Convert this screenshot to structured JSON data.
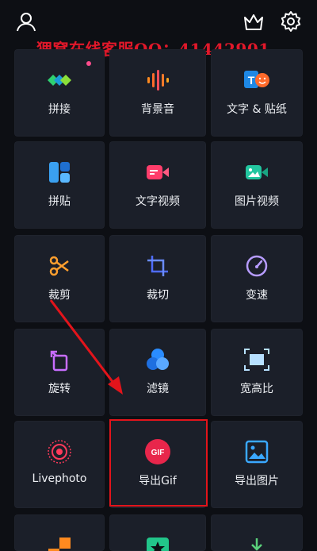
{
  "watermark": "狸窝在线客服QQ：41442901",
  "top_icons": [
    "user-icon",
    "crown-icon",
    "gear-icon"
  ],
  "tiles": [
    {
      "label": "拼接",
      "icon": "splice-icon"
    },
    {
      "label": "背景音",
      "icon": "audio-wave-icon"
    },
    {
      "label": "文字 & 贴纸",
      "icon": "text-sticker-icon"
    },
    {
      "label": "拼贴",
      "icon": "collage-icon"
    },
    {
      "label": "文字视频",
      "icon": "text-video-icon"
    },
    {
      "label": "图片视频",
      "icon": "photo-video-icon"
    },
    {
      "label": "裁剪",
      "icon": "scissors-icon"
    },
    {
      "label": "裁切",
      "icon": "crop-icon"
    },
    {
      "label": "变速",
      "icon": "speedometer-icon"
    },
    {
      "label": "旋转",
      "icon": "rotate-icon"
    },
    {
      "label": "滤镜",
      "icon": "filter-icon"
    },
    {
      "label": "宽高比",
      "icon": "aspect-ratio-icon"
    },
    {
      "label": "Livephoto",
      "icon": "livephoto-icon"
    },
    {
      "label": "导出Gif",
      "icon": "gif-icon",
      "icon_text": "GIF"
    },
    {
      "label": "导出图片",
      "icon": "export-image-icon"
    }
  ],
  "colors": {
    "background": "#0d0f14",
    "tile": "#1b1f29",
    "watermark": "#e0182a",
    "annotation_red": "#e3141b"
  }
}
